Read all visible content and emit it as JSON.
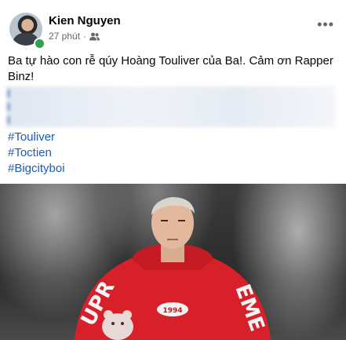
{
  "post": {
    "author": "Kien Nguyen",
    "time": "27 phút",
    "separator": "·",
    "privacy_icon": "friends-icon",
    "more_icon": "•••",
    "text": "Ba tự hào con rễ qúy Hoàng Touliver của Ba!. Cảm ơn Rapper Binz!",
    "hashtags": [
      "#Touliver",
      "#Toctien",
      "#Bigcityboi"
    ]
  },
  "photo": {
    "shirt_text": "SUPREME",
    "chest_print": "1994"
  },
  "colors": {
    "link": "#1b5bb7",
    "online": "#31a24c",
    "hoodie": "#d8202a"
  }
}
